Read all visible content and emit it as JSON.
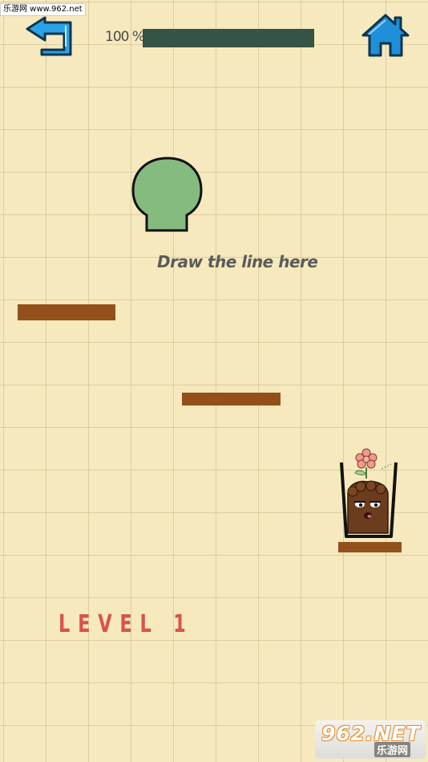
{
  "watermark_top": "乐游网 www.962.net",
  "progress": {
    "label": "100 %",
    "value": 100
  },
  "hint_text": "Draw the line here",
  "level_label": "LEVEL 1",
  "watermark_bottom": {
    "main": "962.NET",
    "sub": "乐游网"
  },
  "icons": {
    "back": "back-arrow-icon",
    "home": "home-icon"
  },
  "colors": {
    "background": "#f5e9bd",
    "plank": "#93501b",
    "blob": "#85bb7f",
    "progress_fill": "#355445",
    "level_text": "#d9534a",
    "button_blue": "#1f8fd8"
  }
}
